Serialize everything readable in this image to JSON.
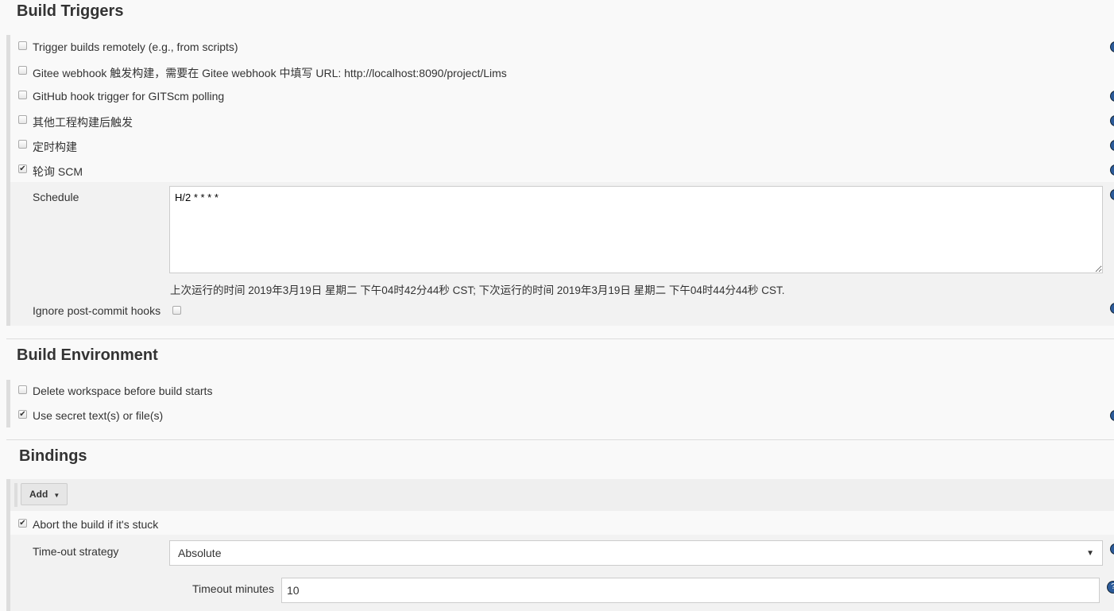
{
  "build_triggers": {
    "title": "Build Triggers",
    "items": [
      {
        "label": "Trigger builds remotely (e.g., from scripts)",
        "checked": false
      },
      {
        "label": "Gitee webhook 触发构建，需要在 Gitee webhook 中填写 URL: http://localhost:8090/project/Lims",
        "checked": false
      },
      {
        "label": "GitHub hook trigger for GITScm polling",
        "checked": false
      },
      {
        "label": "其他工程构建后触发",
        "checked": false
      },
      {
        "label": "定时构建",
        "checked": false
      },
      {
        "label": "轮询 SCM",
        "checked": true
      }
    ],
    "schedule_label": "Schedule",
    "schedule_value": "H/2 * * * *",
    "schedule_info": "上次运行的时间 2019年3月19日 星期二 下午04时42分44秒 CST; 下次运行的时间 2019年3月19日 星期二 下午04时44分44秒 CST.",
    "ignore_hooks_label": "Ignore post-commit hooks",
    "ignore_hooks_checked": false
  },
  "build_environment": {
    "title": "Build Environment",
    "items": [
      {
        "label": "Delete workspace before build starts",
        "checked": false
      },
      {
        "label": "Use secret text(s) or file(s)",
        "checked": true
      }
    ]
  },
  "bindings": {
    "title": "Bindings",
    "add_label": "Add",
    "abort_label": "Abort the build if it's stuck",
    "abort_checked": true,
    "strategy_label": "Time-out strategy",
    "strategy_value": "Absolute",
    "timeout_label": "Timeout minutes",
    "timeout_value": "10"
  },
  "colors": {
    "help_icon": "#2c5b9a"
  }
}
